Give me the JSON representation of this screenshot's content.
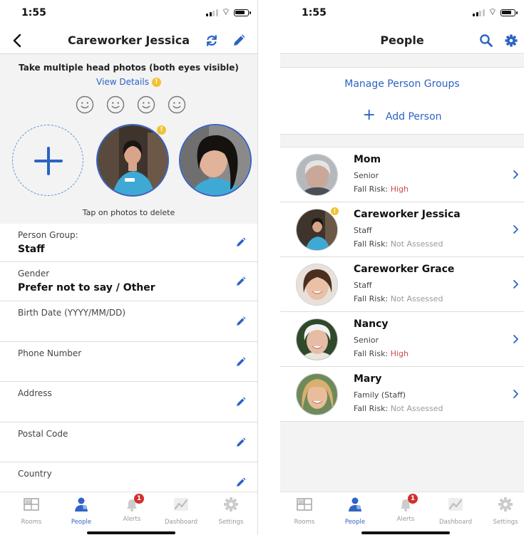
{
  "left_screen": {
    "status_time": "1:55",
    "header_title": "Careworker Jessica",
    "instruction": "Take multiple head photos (both eyes visible)",
    "view_details": "View Details",
    "warn_mark": "!",
    "tap_to_delete": "Tap on photos to delete",
    "fields": [
      {
        "label": "Person Group:",
        "value": "Staff"
      },
      {
        "label": "Gender",
        "value": "Prefer not to say / Other"
      },
      {
        "label": "Birth Date (YYYY/MM/DD)",
        "value": ""
      },
      {
        "label": "Phone Number",
        "value": ""
      },
      {
        "label": "Address",
        "value": ""
      },
      {
        "label": "Postal Code",
        "value": ""
      },
      {
        "label": "Country",
        "value": ""
      }
    ]
  },
  "right_screen": {
    "status_time": "1:55",
    "header_title": "People",
    "manage_groups": "Manage Person Groups",
    "add_person": "Add Person",
    "fall_risk_label": "Fall Risk:",
    "people": [
      {
        "name": "Mom",
        "group": "Senior",
        "fall_risk": "High"
      },
      {
        "name": "Careworker Jessica",
        "group": "Staff",
        "fall_risk": "Not Assessed"
      },
      {
        "name": "Careworker Grace",
        "group": "Staff",
        "fall_risk": "Not Assessed"
      },
      {
        "name": "Nancy",
        "group": "Senior",
        "fall_risk": "High"
      },
      {
        "name": "Mary",
        "group": "Family (Staff)",
        "fall_risk": "Not Assessed"
      }
    ]
  },
  "tabs": [
    {
      "label": "Rooms",
      "icon": "rooms-icon"
    },
    {
      "label": "People",
      "icon": "people-icon"
    },
    {
      "label": "Alerts",
      "icon": "bell-icon",
      "badge": "1"
    },
    {
      "label": "Dashboard",
      "icon": "dashboard-icon"
    },
    {
      "label": "Settings",
      "icon": "gear-icon"
    }
  ],
  "active_tab": "People",
  "colors": {
    "accent": "#2b63c5",
    "high_risk": "#d14a4a",
    "not_assessed": "#9a9a9a",
    "warning": "#f1c232",
    "badge": "#d32f2f"
  }
}
